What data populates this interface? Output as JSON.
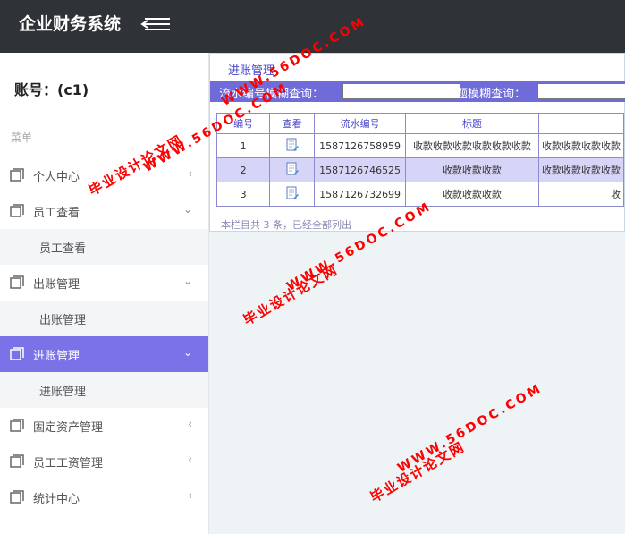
{
  "header": {
    "title": "企业财务系统"
  },
  "sidebar": {
    "account": "账号：(c1)",
    "menu_title": "菜单",
    "items": [
      {
        "label": "个人中心",
        "arrow": "‹"
      },
      {
        "label": "员工查看",
        "arrow": "⌄",
        "sub": "员工查看"
      },
      {
        "label": "出账管理",
        "arrow": "⌄",
        "sub": "出账管理"
      },
      {
        "label": "进账管理",
        "arrow": "⌄",
        "sub": "进账管理"
      },
      {
        "label": "固定资产管理",
        "arrow": "‹"
      },
      {
        "label": "员工工资管理",
        "arrow": "‹"
      },
      {
        "label": "统计中心",
        "arrow": "‹"
      }
    ]
  },
  "main": {
    "panel_title": "进账管理",
    "search": {
      "serial_label": "流水编号模糊查询：",
      "serial_value": "",
      "title_label": "标题模糊查询：",
      "title_value": ""
    },
    "table": {
      "columns": [
        "编号",
        "查看",
        "流水编号",
        "标题",
        ""
      ],
      "rows": [
        {
          "id": "1",
          "serial": "1587126758959",
          "title": "收款收款收款收款收款收款",
          "extra": "收款收款收款收款"
        },
        {
          "id": "2",
          "serial": "1587126746525",
          "title": "收款收款收款",
          "extra": "收款收款收款收款"
        },
        {
          "id": "3",
          "serial": "1587126732699",
          "title": "收款收款收款",
          "extra": "收"
        }
      ]
    },
    "footer": "本栏目共 3 条，已经全部列出"
  },
  "watermark": {
    "site": "WWW.56DOC.COM",
    "name": "毕业设计论文网"
  },
  "colors": {
    "topbar": "#2f3236",
    "accent": "#7b72e8",
    "search_bar": "#6f6bd9",
    "watermark": "#ff0000"
  }
}
